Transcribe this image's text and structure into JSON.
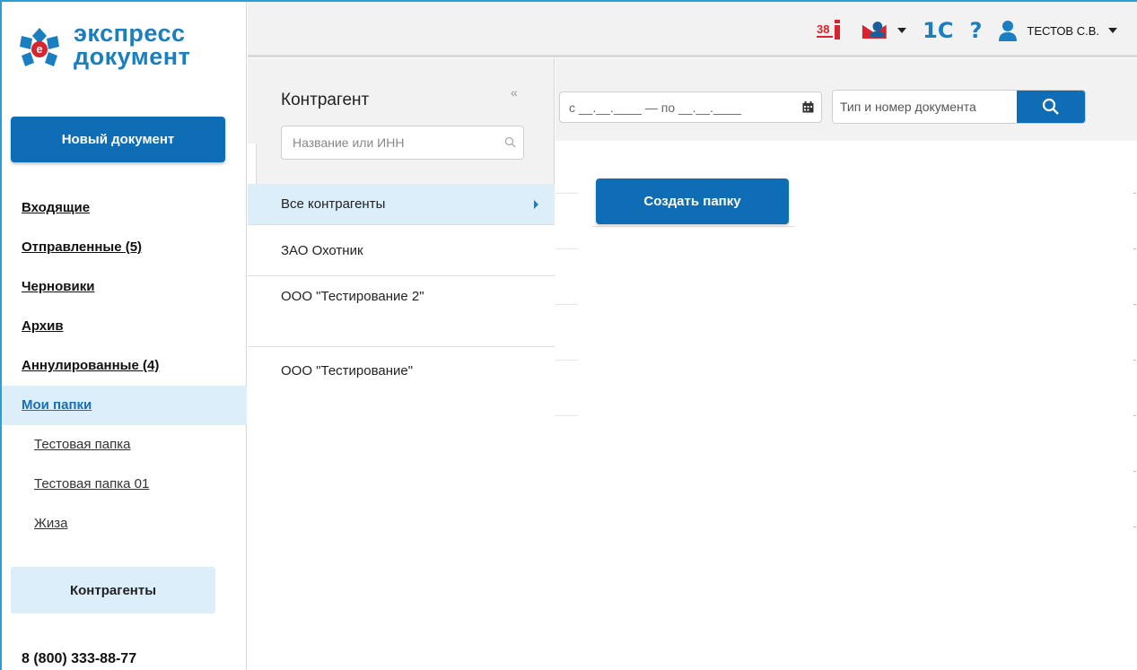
{
  "logo": {
    "line1": "экспресс",
    "line2": "документ",
    "mark_letter": "е"
  },
  "sidebar": {
    "new_document": "Новый документ",
    "nav": [
      {
        "label": "Входящие"
      },
      {
        "label": "Отправленные (5)"
      },
      {
        "label": "Черновики"
      },
      {
        "label": "Архив"
      },
      {
        "label": "Аннулированные (4)"
      },
      {
        "label": "Мои папки",
        "active": true
      }
    ],
    "folders": [
      {
        "label": "Тестовая папка"
      },
      {
        "label": "Тестовая папка 01"
      },
      {
        "label": "Жиза"
      }
    ],
    "contragents_button": "Контрагенты",
    "phone": "8 (800) 333-88-77"
  },
  "topbar": {
    "badge_38": "38",
    "icons": [
      "calendar-38-icon",
      "mail-user-icon",
      "1c-icon",
      "help-icon",
      "user-icon"
    ],
    "label_1c": "1С",
    "help": "?",
    "user_name": "ТЕСТОВ С.В."
  },
  "contragent_panel": {
    "title": "Контрагент",
    "collapse": "«",
    "search_placeholder": "Название или ИНН",
    "items": [
      {
        "label": "Все контрагенты",
        "selected": true
      },
      {
        "label": "ЗАО Охотник"
      },
      {
        "label": "ООО \"Тестирование 2\""
      },
      {
        "label": "ООО \"Тестирование\""
      }
    ]
  },
  "filters": {
    "date_range": "с __.__.____ — по __.__.____",
    "doc_search_placeholder": "Тип и номер документа"
  },
  "main": {
    "create_folder": "Создать папку"
  },
  "colors": {
    "brand_blue": "#0f6db5",
    "accent_blue": "#1a7fc1",
    "highlight": "#dbeefa",
    "red": "#d9232e"
  }
}
